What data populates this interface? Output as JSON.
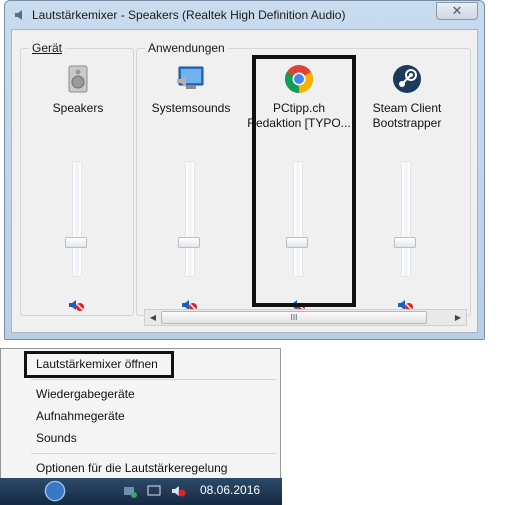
{
  "window": {
    "title": "Lautstärkemixer - Speakers (Realtek High Definition Audio)",
    "close_label": "✕"
  },
  "groups": {
    "device_label": "Gerät",
    "apps_label": "Anwendungen"
  },
  "channels": [
    {
      "name_line1": "Speakers",
      "name_line2": "",
      "icon": "speaker-icon",
      "level": 0.24,
      "muted": true
    },
    {
      "name_line1": "Systemsounds",
      "name_line2": "",
      "icon": "system-sounds-icon",
      "level": 0.24,
      "muted": true
    },
    {
      "name_line1": "PCtipp.ch",
      "name_line2": "Redaktion [TYPO...",
      "icon": "chrome-icon",
      "level": 0.24,
      "muted": true
    },
    {
      "name_line1": "Steam Client",
      "name_line2": "Bootstrapper",
      "icon": "steam-icon",
      "level": 0.24,
      "muted": true
    }
  ],
  "scrollbar": {
    "thumb_grip": "III",
    "left_arrow": "◀",
    "right_arrow": "▶"
  },
  "menu": {
    "items": [
      "Lautstärkemixer öffnen",
      "Wiedergabegeräte",
      "Aufnahmegeräte",
      "Sounds",
      "Optionen für die Lautstärkeregelung"
    ]
  },
  "taskbar": {
    "date": "08.06.2016"
  },
  "colors": {
    "mute_red": "#e0212a",
    "speaker_blue": "#1c5fbf",
    "highlight": "#111111"
  }
}
